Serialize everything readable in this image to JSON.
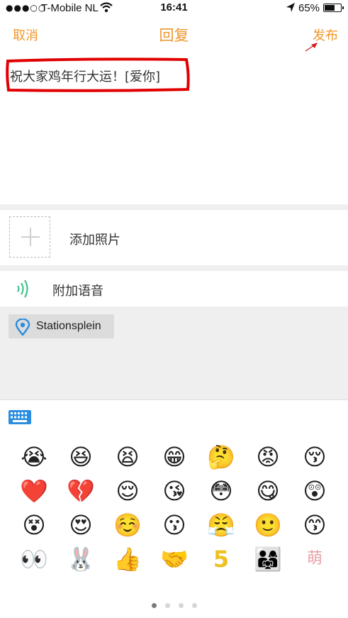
{
  "status_bar": {
    "signal": "●●●○○",
    "carrier": "T-Mobile NL",
    "time": "16:41",
    "battery": "65%"
  },
  "nav": {
    "cancel": "取消",
    "title": "回复",
    "publish": "发布",
    "accent_color": "#f0962a"
  },
  "compose": {
    "text": "祝大家鸡年行大运！[爱你]"
  },
  "attachments": {
    "add_photo": "添加照片",
    "add_voice": "附加语音",
    "location": "Stationsplein"
  },
  "emoji": {
    "rows": [
      [
        "😭",
        "😆",
        "😫",
        "😁",
        "🤔",
        "😡",
        "😚"
      ],
      [
        "❤️",
        "💔",
        "😌",
        "😘",
        "😳",
        "😋",
        "😲"
      ],
      [
        "😵",
        "😍",
        "☺️",
        "😗",
        "😤",
        "🙂",
        "😙"
      ],
      [
        "👀",
        "🐰",
        "👍",
        "🤝",
        "5",
        "👨‍👩‍👧",
        "萌"
      ]
    ],
    "page_count": 4,
    "active_page": 1
  }
}
